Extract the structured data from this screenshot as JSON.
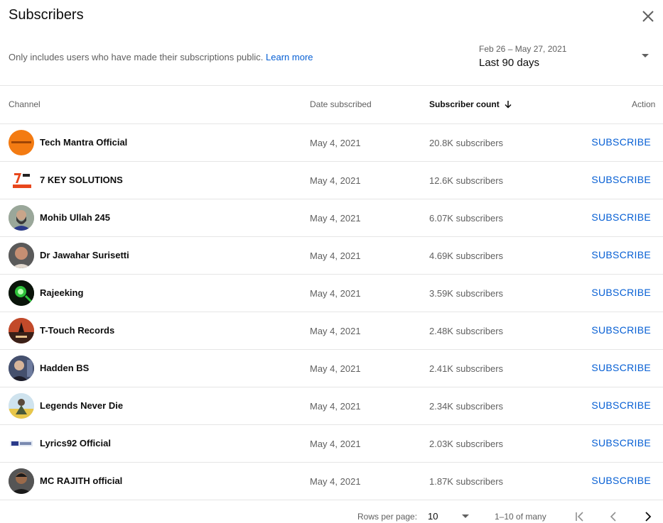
{
  "dialog": {
    "title": "Subscribers",
    "note": "Only includes users who have made their subscriptions public.",
    "learn_more": "Learn more",
    "date_range": "Feb 26 – May 27, 2021",
    "date_label": "Last 90 days"
  },
  "columns": {
    "channel": "Channel",
    "date": "Date subscribed",
    "count": "Subscriber count",
    "action": "Action"
  },
  "rows": [
    {
      "name": "Tech Mantra Official",
      "date": "May 4, 2021",
      "count": "20.8K subscribers",
      "action": "SUBSCRIBE"
    },
    {
      "name": "7 KEY SOLUTIONS",
      "date": "May 4, 2021",
      "count": "12.6K subscribers",
      "action": "SUBSCRIBE"
    },
    {
      "name": "Mohib Ullah 245",
      "date": "May 4, 2021",
      "count": "6.07K subscribers",
      "action": "SUBSCRIBE"
    },
    {
      "name": "Dr Jawahar Surisetti",
      "date": "May 4, 2021",
      "count": "4.69K subscribers",
      "action": "SUBSCRIBE"
    },
    {
      "name": "Rajeeking",
      "date": "May 4, 2021",
      "count": "3.59K subscribers",
      "action": "SUBSCRIBE"
    },
    {
      "name": "T-Touch Records",
      "date": "May 4, 2021",
      "count": "2.48K subscribers",
      "action": "SUBSCRIBE"
    },
    {
      "name": "Hadden BS",
      "date": "May 4, 2021",
      "count": "2.41K subscribers",
      "action": "SUBSCRIBE"
    },
    {
      "name": "Legends Never Die",
      "date": "May 4, 2021",
      "count": "2.34K subscribers",
      "action": "SUBSCRIBE"
    },
    {
      "name": "Lyrics92 Official",
      "date": "May 4, 2021",
      "count": "2.03K subscribers",
      "action": "SUBSCRIBE"
    },
    {
      "name": "MC RAJITH official",
      "date": "May 4, 2021",
      "count": "1.87K subscribers",
      "action": "SUBSCRIBE"
    }
  ],
  "footer": {
    "rows_per_page_label": "Rows per page:",
    "rows_per_page_value": "10",
    "range": "1–10 of many"
  },
  "icons": {
    "close": "close-icon",
    "dropdown": "arrow-drop-down-icon",
    "sort": "arrow-down-icon",
    "first": "first-page-icon",
    "prev": "chevron-left-icon",
    "next": "chevron-right-icon"
  },
  "colors": {
    "accent": "#065fd4",
    "text_primary": "#0d0d0d",
    "text_secondary": "#606060",
    "divider": "#e5e5e5"
  }
}
